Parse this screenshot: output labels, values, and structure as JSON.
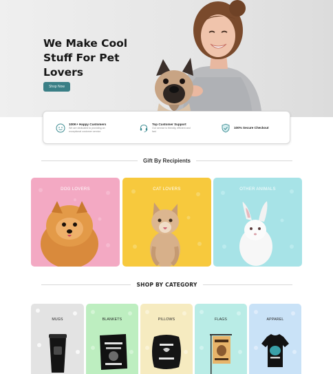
{
  "hero": {
    "title": "We Make Cool Stuff For Pet Lovers",
    "button_label": "Shop Now"
  },
  "features": [
    {
      "icon": "smile-badge-icon",
      "title": "100K+ Happy Customers",
      "desc": "We are dedicated to providing an exceptional customer service"
    },
    {
      "icon": "support-headset-icon",
      "title": "Top Customer Support",
      "desc": "Our service is friendly, efficient and fast"
    },
    {
      "icon": "shield-check-icon",
      "title": "100% Secure Checkout",
      "desc": ""
    }
  ],
  "recipients": {
    "heading": "Gift By Recipients",
    "cards": [
      {
        "label": "DOG LOVERS",
        "color": "#f3a9c3"
      },
      {
        "label": "CAT LOVERS",
        "color": "#f7c93d"
      },
      {
        "label": "OTHER ANIMALS",
        "color": "#a7e3e7"
      }
    ]
  },
  "categories": {
    "heading": "SHOP BY CATEGORY",
    "cards": [
      {
        "label": "MUGS",
        "color": "#e3e3e3"
      },
      {
        "label": "BLANKETS",
        "color": "#bdeec0"
      },
      {
        "label": "PILLOWS",
        "color": "#f6ebc0"
      },
      {
        "label": "FLAGS",
        "color": "#b9ece6"
      },
      {
        "label": "APPAREL",
        "color": "#c9e2f7"
      }
    ]
  },
  "colors": {
    "accent": "#3a7f86",
    "hero_bg": "#e9e9e9"
  }
}
